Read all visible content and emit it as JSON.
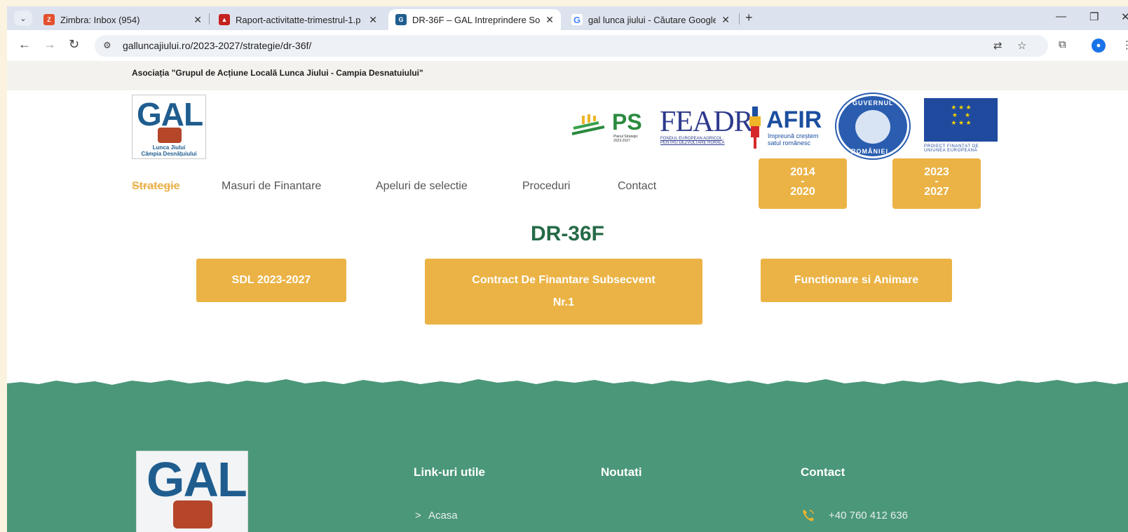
{
  "browser": {
    "tabs": [
      {
        "title": "Zimbra: Inbox (954)",
        "icon": "zimbra-icon",
        "color": "#e3502e",
        "active": false
      },
      {
        "title": "Raport-activitatte-trimestrul-1.p",
        "icon": "pdf-icon",
        "color": "#c5221f",
        "active": false
      },
      {
        "title": "DR-36F – GAL Intreprindere Soc",
        "icon": "gal-favicon",
        "color": "#1f5d8f",
        "active": true
      },
      {
        "title": "gal lunca jiului - Căutare Google",
        "icon": "google-icon",
        "color": "#4285f4",
        "active": false
      }
    ],
    "url": "galluncajiului.ro/2023-2027/strategie/dr-36f/"
  },
  "header": {
    "association": "Asociația \"Grupul de Acțiune Locală Lunca Jiului - Campia Desnatuiului\"",
    "logo": {
      "main": "GAL",
      "line1": "Lunca Jiului",
      "line2": "Câmpia Desnățuiului"
    },
    "partners": {
      "ps": {
        "name": "PS",
        "sub": "Planul Strategic 2023-2027"
      },
      "feadr": {
        "name": "FEADR",
        "sub": "FONDUL EUROPEAN AGRICOL PENTRU DEZVOLTARE RURALĂ"
      },
      "afir": {
        "name": "AFIR",
        "sub": "împreună creștem satul românesc"
      },
      "gov": {
        "top": "GUVERNUL",
        "bottom": "ROMÂNIEI"
      },
      "eu": {
        "sub": "PROIECT FINANȚAT DE UNIUNEA EUROPEANĂ"
      }
    }
  },
  "nav": {
    "items": [
      "Strategie",
      "Masuri de Finantare",
      "Apeluri de selectie",
      "Proceduri",
      "Contact"
    ],
    "active": "Strategie",
    "periods": [
      {
        "from": "2014",
        "sep": "-",
        "to": "2020"
      },
      {
        "from": "2023",
        "sep": "-",
        "to": "2027"
      }
    ]
  },
  "main": {
    "title": "DR-36F",
    "buttons": [
      {
        "line1": "SDL 2023-2027",
        "line2": ""
      },
      {
        "line1": "Contract De Finantare Subsecvent",
        "line2": "Nr.1"
      },
      {
        "line1": "Functionare si Animare",
        "line2": ""
      }
    ]
  },
  "footer": {
    "logo": "GAL",
    "headings": [
      "Link-uri utile",
      "Noutati",
      "Contact"
    ],
    "links": [
      "Acasa"
    ],
    "link_prefix": ">",
    "phone": "+40 760 412 636"
  },
  "colors": {
    "accent": "#ebb345",
    "title_green": "#256a47",
    "footer_green": "#4b977a"
  }
}
